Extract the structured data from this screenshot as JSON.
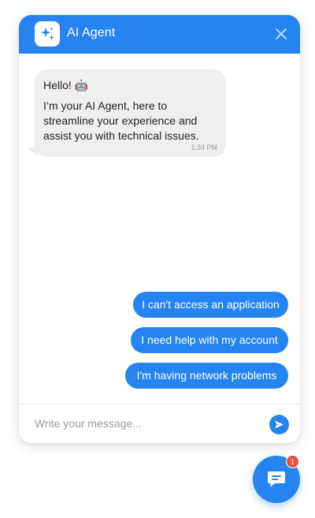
{
  "header": {
    "title": "AI Agent",
    "avatar_icon": "sparkle-icon",
    "close_icon": "close-icon"
  },
  "messages": [
    {
      "sender": "bot",
      "greeting": "Hello! 🤖",
      "body": "I’m your AI Agent, here to streamline your experience and assist you with technical issues.",
      "time": "1:34 PM"
    }
  ],
  "quick_replies": [
    "I can't access an application",
    "I need help with my account",
    "I'm having network problems"
  ],
  "composer": {
    "placeholder": "Write your message...",
    "value": "",
    "send_icon": "send-icon"
  },
  "launcher": {
    "icon": "chat-icon",
    "badge_count": "1"
  },
  "colors": {
    "accent": "#2684f0",
    "bubble_bg": "#efefef",
    "badge": "#ef4b3f"
  }
}
